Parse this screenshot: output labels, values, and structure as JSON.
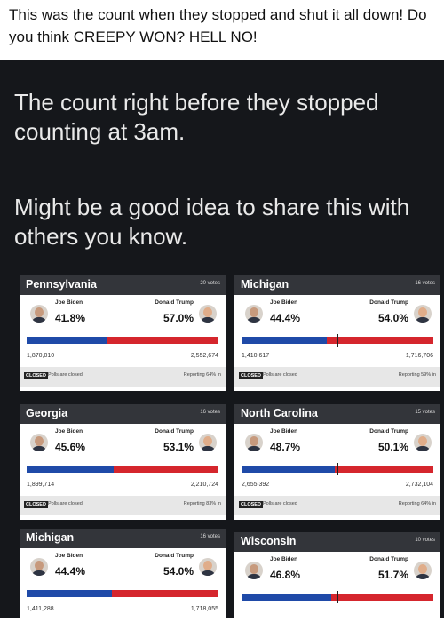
{
  "caption": "This was the count when they stopped and shut it all down! Do you think CREEPY WON? HELL NO!",
  "headline": "The count right before they stopped counting at 3am.",
  "subhead": "Might be a good idea to share this with others you know.",
  "closed_label": "CLOSED",
  "polls_closed": "Polls are closed",
  "cards": [
    {
      "state": "Pennsylvania",
      "votes": "20 votes",
      "biden": "Joe Biden",
      "trump": "Donald Trump",
      "biden_pct": "41.8%",
      "trump_pct": "57.0%",
      "biden_votes": "1,870,010",
      "trump_votes": "2,552,674",
      "reporting": "Reporting 64% in",
      "biden_share": 0.418
    },
    {
      "state": "Michigan",
      "votes": "16 votes",
      "biden": "Joe Biden",
      "trump": "Donald Trump",
      "biden_pct": "44.4%",
      "trump_pct": "54.0%",
      "biden_votes": "1,410,617",
      "trump_votes": "1,716,706",
      "reporting": "Reporting 59% in",
      "biden_share": 0.444
    },
    {
      "state": "Georgia",
      "votes": "16 votes",
      "biden": "Joe Biden",
      "trump": "Donald Trump",
      "biden_pct": "45.6%",
      "trump_pct": "53.1%",
      "biden_votes": "1,899,714",
      "trump_votes": "2,210,724",
      "reporting": "Reporting 83% in",
      "biden_share": 0.456
    },
    {
      "state": "North Carolina",
      "votes": "15 votes",
      "biden": "Joe Biden",
      "trump": "Donald Trump",
      "biden_pct": "48.7%",
      "trump_pct": "50.1%",
      "biden_votes": "2,655,392",
      "trump_votes": "2,732,104",
      "reporting": "Reporting 64% in",
      "biden_share": 0.487
    },
    {
      "state": "Michigan",
      "votes": "16 votes",
      "biden": "Joe Biden",
      "trump": "Donald Trump",
      "biden_pct": "44.4%",
      "trump_pct": "54.0%",
      "biden_votes": "1,411,288",
      "trump_votes": "1,718,055",
      "reporting": "",
      "biden_share": 0.444
    },
    {
      "state": "Wisconsin",
      "votes": "10 votes",
      "biden": "Joe Biden",
      "trump": "Donald Trump",
      "biden_pct": "46.8%",
      "trump_pct": "51.7%",
      "biden_votes": "",
      "trump_votes": "",
      "reporting": "",
      "biden_share": 0.468
    }
  ]
}
